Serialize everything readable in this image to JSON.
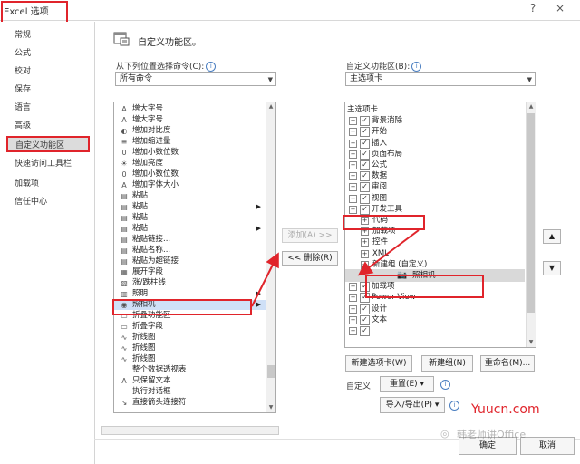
{
  "window": {
    "title": "Excel 选项",
    "help": "?",
    "close": "×"
  },
  "sidebar": {
    "items": [
      {
        "label": "常规"
      },
      {
        "label": "公式"
      },
      {
        "label": "校对"
      },
      {
        "label": "保存"
      },
      {
        "label": "语言"
      },
      {
        "label": "高级"
      },
      {
        "label": "自定义功能区",
        "selected": true
      },
      {
        "label": "快速访问工具栏"
      },
      {
        "label": "加载项"
      },
      {
        "label": "信任中心"
      }
    ]
  },
  "header": {
    "title": "自定义功能区。"
  },
  "left": {
    "label": "从下列位置选择命令(C):",
    "dropdown_value": "所有命令",
    "commands": [
      {
        "icon": "A",
        "label": "增大字号"
      },
      {
        "icon": "A",
        "label": "增大字号"
      },
      {
        "icon": "◐",
        "label": "增加对比度"
      },
      {
        "icon": "≡",
        "label": "增加缩进量"
      },
      {
        "icon": "0",
        "label": "增加小数位数"
      },
      {
        "icon": "☀",
        "label": "增加亮度"
      },
      {
        "icon": "0",
        "label": "增加小数位数"
      },
      {
        "icon": "A",
        "label": "增加字体大小"
      },
      {
        "icon": "▤",
        "label": "粘贴"
      },
      {
        "icon": "▤",
        "label": "粘贴"
      },
      {
        "icon": "▤",
        "label": "粘贴"
      },
      {
        "icon": "▤",
        "label": "粘贴"
      },
      {
        "icon": "▤",
        "label": "粘贴链接..."
      },
      {
        "icon": "▤",
        "label": "粘贴名称..."
      },
      {
        "icon": "▤",
        "label": "粘贴为超链接"
      },
      {
        "icon": "▦",
        "label": "展开字段"
      },
      {
        "icon": "▧",
        "label": "涨/跌柱线"
      },
      {
        "icon": "▥",
        "label": "照明"
      },
      {
        "icon": "◉",
        "label": "照相机",
        "selected": true
      },
      {
        "icon": "▭",
        "label": "折叠功能区"
      },
      {
        "icon": "▭",
        "label": "折叠字段"
      },
      {
        "icon": "∿",
        "label": "折线图"
      },
      {
        "icon": "∿",
        "label": "折线图"
      },
      {
        "icon": "∿",
        "label": "折线图"
      },
      {
        "icon": "",
        "label": "整个数据透视表"
      },
      {
        "icon": "A",
        "label": "只保留文本"
      },
      {
        "icon": "",
        "label": "执行对话框"
      },
      {
        "icon": "↘",
        "label": "直接箭头连接符"
      }
    ]
  },
  "middle": {
    "add": "添加(A) >>",
    "remove": "<< 删除(R)"
  },
  "right": {
    "label": "自定义功能区(B):",
    "dropdown_value": "主选项卡",
    "tree": [
      {
        "label": "主选项卡",
        "level": 0,
        "type": "header"
      },
      {
        "label": "背景消除",
        "level": 0,
        "exp": "+",
        "check": true
      },
      {
        "label": "开始",
        "level": 0,
        "exp": "+",
        "check": true
      },
      {
        "label": "插入",
        "level": 0,
        "exp": "+",
        "check": true
      },
      {
        "label": "页面布局",
        "level": 0,
        "exp": "+",
        "check": true
      },
      {
        "label": "公式",
        "level": 0,
        "exp": "+",
        "check": true
      },
      {
        "label": "数据",
        "level": 0,
        "exp": "+",
        "check": true
      },
      {
        "label": "审阅",
        "level": 0,
        "exp": "+",
        "check": true
      },
      {
        "label": "视图",
        "level": 0,
        "exp": "+",
        "check": true
      },
      {
        "label": "开发工具",
        "level": 0,
        "exp": "−",
        "check": true
      },
      {
        "label": "代码",
        "level": 1,
        "exp": "+"
      },
      {
        "label": "加载项",
        "level": 1,
        "exp": "+"
      },
      {
        "label": "控件",
        "level": 1,
        "exp": "+"
      },
      {
        "label": "XML",
        "level": 1,
        "exp": "+"
      },
      {
        "label": "新建组 (自定义)",
        "level": 1,
        "exp": "−"
      },
      {
        "label": "照相机",
        "level": 2,
        "type": "item"
      },
      {
        "label": "加载项",
        "level": 0,
        "exp": "+",
        "check": true
      },
      {
        "label": "Power View",
        "level": 0,
        "exp": "+",
        "check": true
      },
      {
        "label": "设计",
        "level": 0,
        "exp": "+",
        "check": true
      },
      {
        "label": "文本",
        "level": 0,
        "exp": "+",
        "check": true
      },
      {
        "label": "",
        "level": 0,
        "exp": "+",
        "check": true
      }
    ],
    "new_tab": "新建选项卡(W)",
    "new_group": "新建组(N)",
    "rename": "重命名(M)...",
    "customize_label": "自定义:",
    "reset": "重置(E) ▾",
    "import_export": "导入/导出(P) ▾"
  },
  "footer": {
    "ok": "确定",
    "cancel": "取消"
  },
  "watermark": {
    "site": "Yuucn.com",
    "account": "韩老师讲Office"
  }
}
